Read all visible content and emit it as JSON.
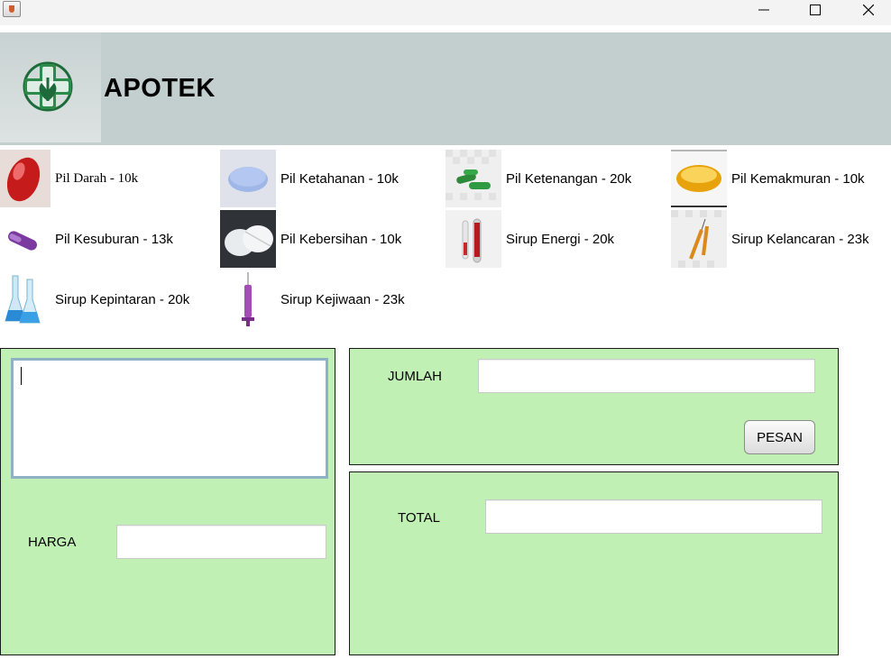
{
  "window": {
    "controls": {
      "minimize_icon": "minimize-icon",
      "maximize_icon": "maximize-icon",
      "close_icon": "close-icon"
    }
  },
  "header": {
    "title": "APOTEK",
    "background": "#c3cfcf",
    "logo_icon": "pharmacy-cross-logo"
  },
  "products": [
    {
      "label": "Pil Darah - 10k"
    },
    {
      "label": "Pil Ketahanan - 10k"
    },
    {
      "label": "Pil Ketenangan - 20k"
    },
    {
      "label": "Pil Kemakmuran - 10k"
    },
    {
      "label": "Pil Kesuburan - 13k"
    },
    {
      "label": "Pil Kebersihan - 10k"
    },
    {
      "label": "Sirup Energi - 20k"
    },
    {
      "label": "Sirup Kelancaran - 23k"
    },
    {
      "label": "Sirup Kepintaran - 20k"
    },
    {
      "label": "Sirup Kejiwaan - 23k"
    }
  ],
  "order_panel": {
    "notes_value": "",
    "harga_label": "HARGA",
    "harga_value": ""
  },
  "quantity_panel": {
    "jumlah_label": "JUMLAH",
    "jumlah_value": "",
    "pesan_label": "PESAN"
  },
  "total_panel": {
    "total_label": "TOTAL",
    "total_value": ""
  },
  "colors": {
    "panel_green": "#c0f0b4",
    "textarea_border": "#8fb1c5"
  }
}
